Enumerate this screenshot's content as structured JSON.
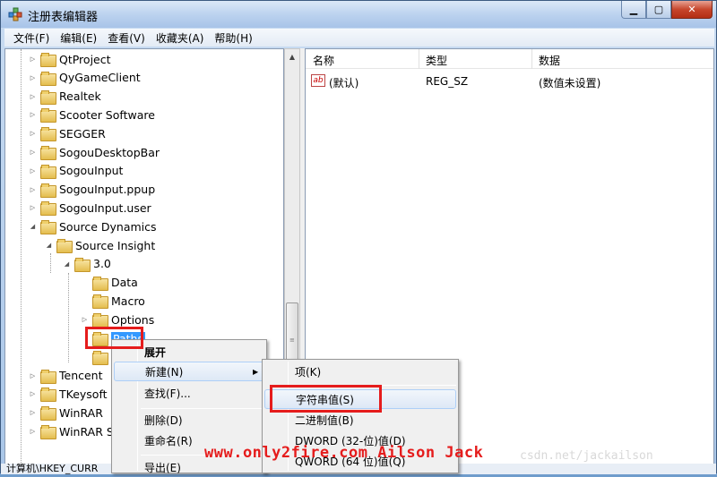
{
  "window": {
    "title": "注册表编辑器",
    "minimize": "▁",
    "maximize": "▢",
    "close": "✕"
  },
  "menu": [
    "文件(F)",
    "编辑(E)",
    "查看(V)",
    "收藏夹(A)",
    "帮助(H)"
  ],
  "tree": {
    "items": [
      {
        "label": "QtProject",
        "level": 0
      },
      {
        "label": "QyGameClient",
        "level": 0
      },
      {
        "label": "Realtek",
        "level": 0
      },
      {
        "label": "Scooter Software",
        "level": 0
      },
      {
        "label": "SEGGER",
        "level": 0
      },
      {
        "label": "SogouDesktopBar",
        "level": 0
      },
      {
        "label": "SogouInput",
        "level": 0
      },
      {
        "label": "SogouInput.ppup",
        "level": 0
      },
      {
        "label": "SogouInput.user",
        "level": 0
      },
      {
        "label": "Source Dynamics",
        "level": 0,
        "expanded": true
      },
      {
        "label": "Source Insight",
        "level": 1,
        "expanded": true
      },
      {
        "label": "3.0",
        "level": 2,
        "expanded": true
      },
      {
        "label": "Data",
        "level": 3
      },
      {
        "label": "Macro",
        "level": 3
      },
      {
        "label": "Options",
        "level": 3
      },
      {
        "label": "Paths",
        "level": 3,
        "selected": true
      },
      {
        "label": "",
        "level": 3
      },
      {
        "label": "Tencent",
        "level": 0
      },
      {
        "label": "TKeysoft",
        "level": 0
      },
      {
        "label": "WinRAR",
        "level": 0
      },
      {
        "label": "WinRAR SF",
        "level": 0
      }
    ]
  },
  "list": {
    "columns": [
      "名称",
      "类型",
      "数据"
    ],
    "rows": [
      {
        "icon": "ab",
        "name": "(默认)",
        "type": "REG_SZ",
        "data": "(数值未设置)"
      }
    ]
  },
  "status": "计算机\\HKEY_CURR",
  "context_menu": {
    "items": [
      "展开",
      "新建(N)",
      "查找(F)...",
      "删除(D)",
      "重命名(R)",
      "导出(E)"
    ]
  },
  "submenu": {
    "items": [
      "项(K)",
      "字符串值(S)",
      "二进制值(B)",
      "DWORD (32-位)值(D)",
      "QWORD (64 位)值(Q)"
    ]
  },
  "watermark": "www.only2fire.com Ailson Jack",
  "watermark_faint": "csdn.net/jackailson"
}
